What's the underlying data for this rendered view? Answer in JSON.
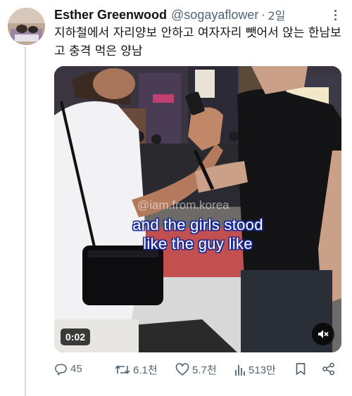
{
  "author": {
    "display_name": "Esther Greenwood",
    "handle": "@sogayaflower",
    "separator": "·",
    "time": "2일"
  },
  "tweet": {
    "text": "지하철에서 자리양보 안하고 여자자리 뺏어서 앉는 한남보고 충격 먹은 양남"
  },
  "media": {
    "type": "video",
    "watermark": "@iam.from.korea",
    "subtitle_line1": "and the girls stood",
    "subtitle_line2": "like the guy like",
    "duration": "0:02",
    "subtitle_colors": {
      "text": "#ffffff",
      "outline": "#1a2a9a"
    }
  },
  "actions": {
    "replies": "45",
    "retweets": "6.1천",
    "likes": "5.7천",
    "views": "513만"
  },
  "icons": {
    "avatar": "avatar-image",
    "more": "more-icon",
    "reply": "reply-icon",
    "retweet": "retweet-icon",
    "like": "heart-icon",
    "views": "views-icon",
    "bookmark": "bookmark-icon",
    "share": "share-icon",
    "mute": "mute-icon"
  },
  "colors": {
    "text_primary": "#0f1419",
    "text_secondary": "#536471",
    "thread_line": "#cfd9de"
  }
}
